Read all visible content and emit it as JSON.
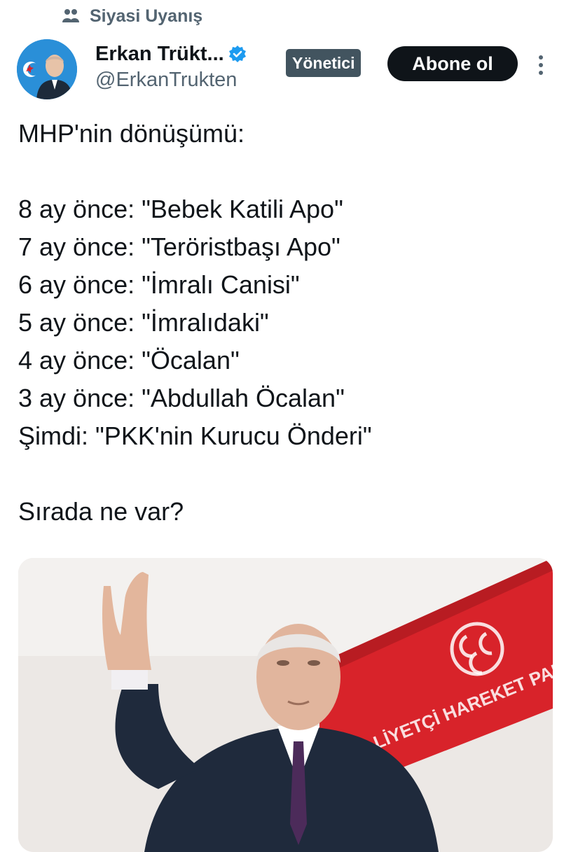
{
  "community": {
    "name": "Siyasi Uyanış",
    "icon": "community-icon"
  },
  "author": {
    "name": "Erkan Trükt...",
    "handle": "@ErkanTrukten",
    "verified": true,
    "role_badge": "Yönetici",
    "avatar": "avatar"
  },
  "actions": {
    "subscribe_label": "Abone ol",
    "more_icon": "more-options-icon"
  },
  "tweet": {
    "title": "MHP'nin dönüşümü:",
    "lines": [
      "8 ay önce: \"Bebek Katili Apo\"",
      "7 ay önce: \"Teröristbaşı Apo\"",
      "6 ay önce: \"İmralı Canisi\"",
      "5 ay önce: \"İmralıdaki\"",
      "4 ay önce: \"Öcalan\"",
      "3 ay önce: \"Abdullah Öcalan\"",
      "Şimdi: \"PKK'nin Kurucu Önderi\""
    ],
    "closing": "Sırada ne var?"
  },
  "media": {
    "banner_text": "MİLLİYETÇİ HAREKET PARTİSİ"
  },
  "colors": {
    "text": "#0f1419",
    "secondary": "#536471",
    "verified": "#1d9bf0",
    "badge": "#42545f",
    "subscribe_bg": "#0f1419",
    "banner_red": "#d8232a"
  }
}
